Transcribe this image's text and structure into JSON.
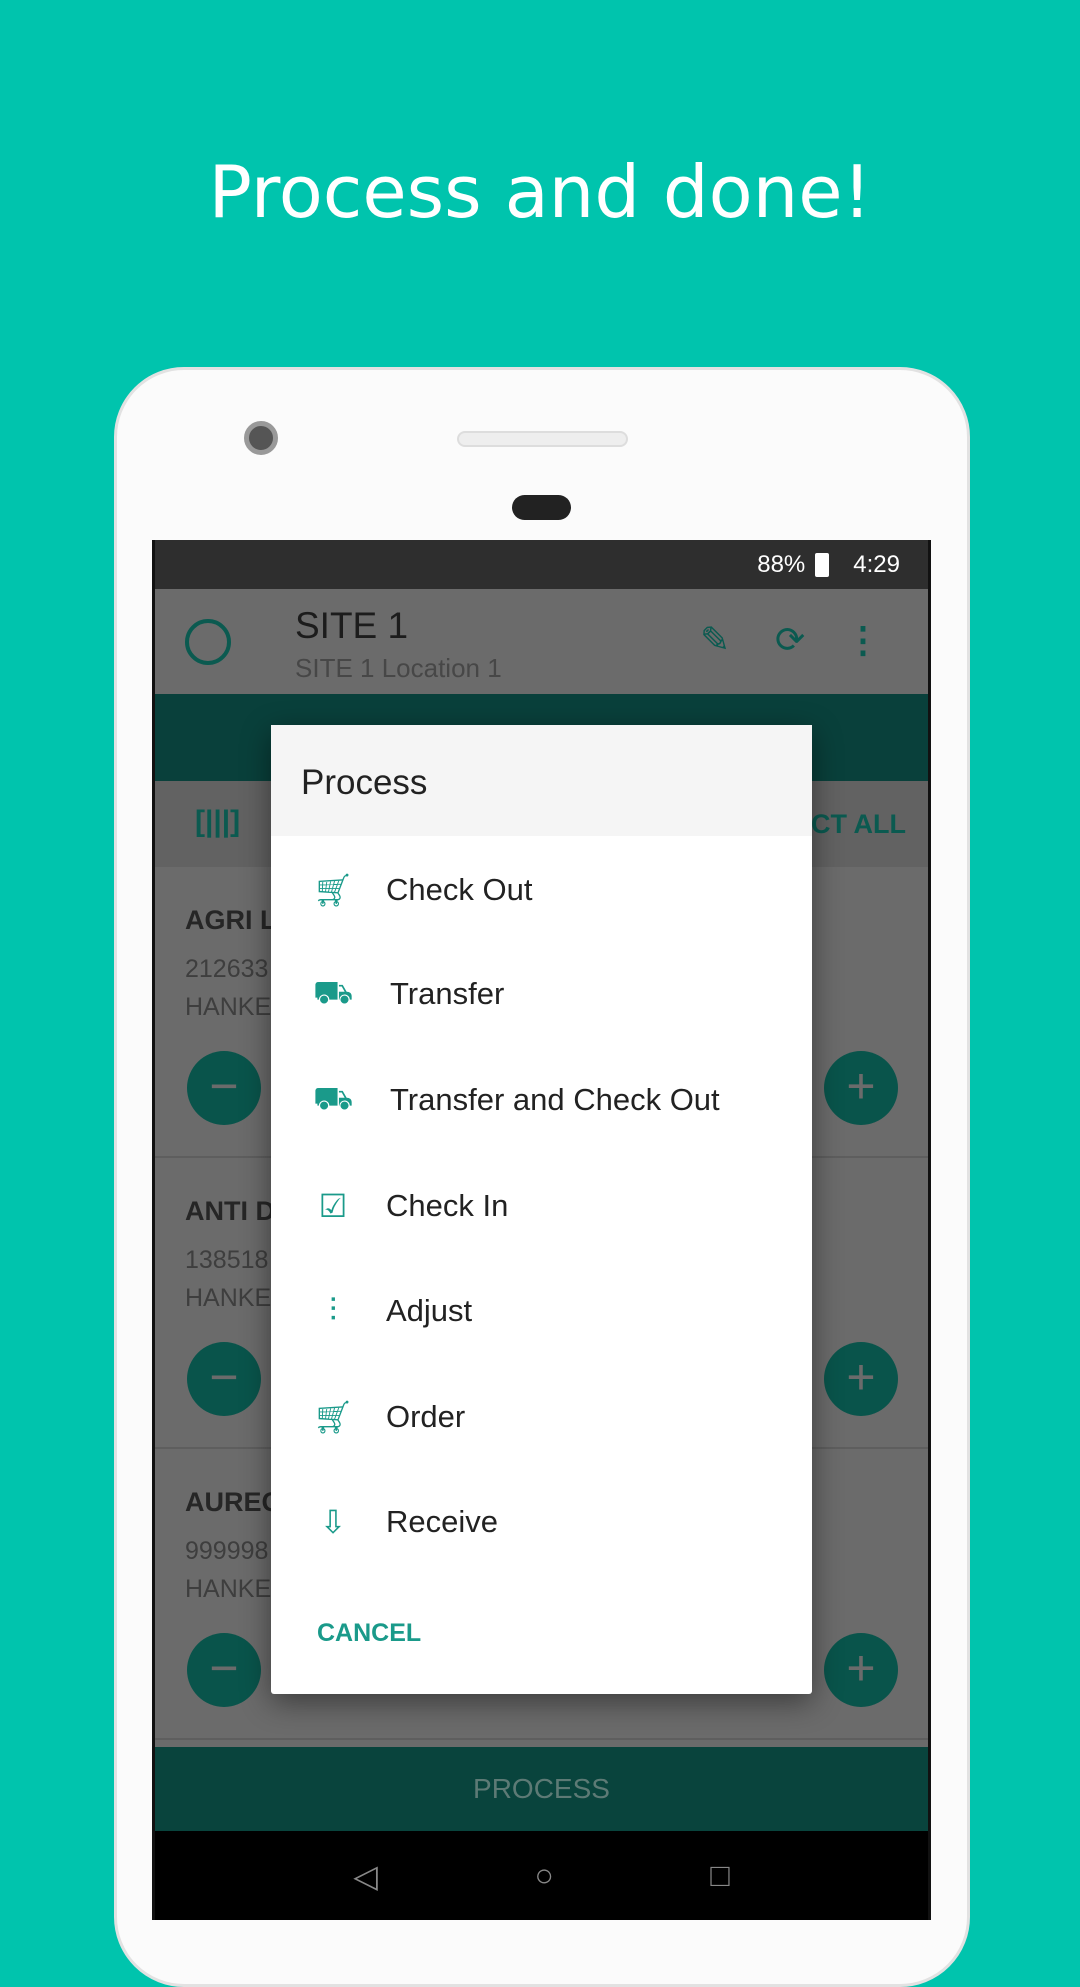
{
  "headline": "Process and done!",
  "status": {
    "battery": "88%",
    "time": "4:29"
  },
  "appbar": {
    "title": "SITE 1",
    "subtitle": "SITE 1 Location 1"
  },
  "toolbar": {
    "select_all": "ECT ALL"
  },
  "items": [
    {
      "name": "AGRI L",
      "number": "212633",
      "maker": "HANKE"
    },
    {
      "name": "ANTI D",
      "number": "138518",
      "maker": "HANKE"
    },
    {
      "name": "AUREC",
      "number": "999998",
      "maker": "HANKE"
    }
  ],
  "process_button": "PROCESS",
  "dialog": {
    "title": "Process",
    "options": [
      {
        "label": "Check Out",
        "icon": "cart-check-icon"
      },
      {
        "label": "Transfer",
        "icon": "truck-icon"
      },
      {
        "label": "Transfer and Check Out",
        "icon": "truck-check-icon"
      },
      {
        "label": "Check In",
        "icon": "checkbox-icon"
      },
      {
        "label": "Adjust",
        "icon": "sliders-icon"
      },
      {
        "label": "Order",
        "icon": "cart-plus-icon"
      },
      {
        "label": "Receive",
        "icon": "inbox-download-icon"
      }
    ],
    "cancel": "CANCEL"
  },
  "colors": {
    "background": "#00c4ad",
    "accent": "#1a9a8a",
    "dark_teal": "#09443d"
  }
}
